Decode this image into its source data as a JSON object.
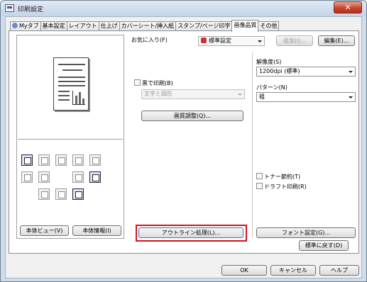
{
  "window": {
    "title": "印刷設定",
    "close_glyph": "✕"
  },
  "tabs": [
    {
      "label": "Myタブ",
      "active": false
    },
    {
      "label": "基本設定",
      "active": false
    },
    {
      "label": "レイアウト",
      "active": false
    },
    {
      "label": "仕上げ",
      "active": false
    },
    {
      "label": "カバーシート/挿入紙",
      "active": false
    },
    {
      "label": "スタンプ/ページ印字",
      "active": false
    },
    {
      "label": "画像品質",
      "active": true
    },
    {
      "label": "その他",
      "active": false
    }
  ],
  "left_pane": {
    "view_button": "本体ビュー(V)",
    "info_button": "本体情報(I)"
  },
  "favorites": {
    "label": "お気に入り(F)",
    "value": "標準設定",
    "add_button": "追加(I)...",
    "edit_button": "編集(E)..."
  },
  "black_print": {
    "label": "黒で印刷(B)",
    "combo_value": "文字と図形"
  },
  "quality_adjust_button": "画質調整(Q)...",
  "resolution": {
    "label": "解像度(S)",
    "value": "1200dpi (標準)"
  },
  "pattern": {
    "label": "パターン(N)",
    "value": "粗"
  },
  "toner_save": {
    "label": "トナー節約(T)"
  },
  "draft_print": {
    "label": "ドラフト印刷(R)"
  },
  "outline_button": "アウトライン処理(L)...",
  "font_settings_button": "フォント設定(G)...",
  "reset_button": "標準に戻す(D)",
  "footer": {
    "ok": "OK",
    "cancel": "キャンセル",
    "help": "ヘルプ"
  },
  "icons": {
    "app": "printer-settings-icon",
    "preset": "favorite-preset-icon",
    "tab_pin": "mytab-pin-icon"
  }
}
